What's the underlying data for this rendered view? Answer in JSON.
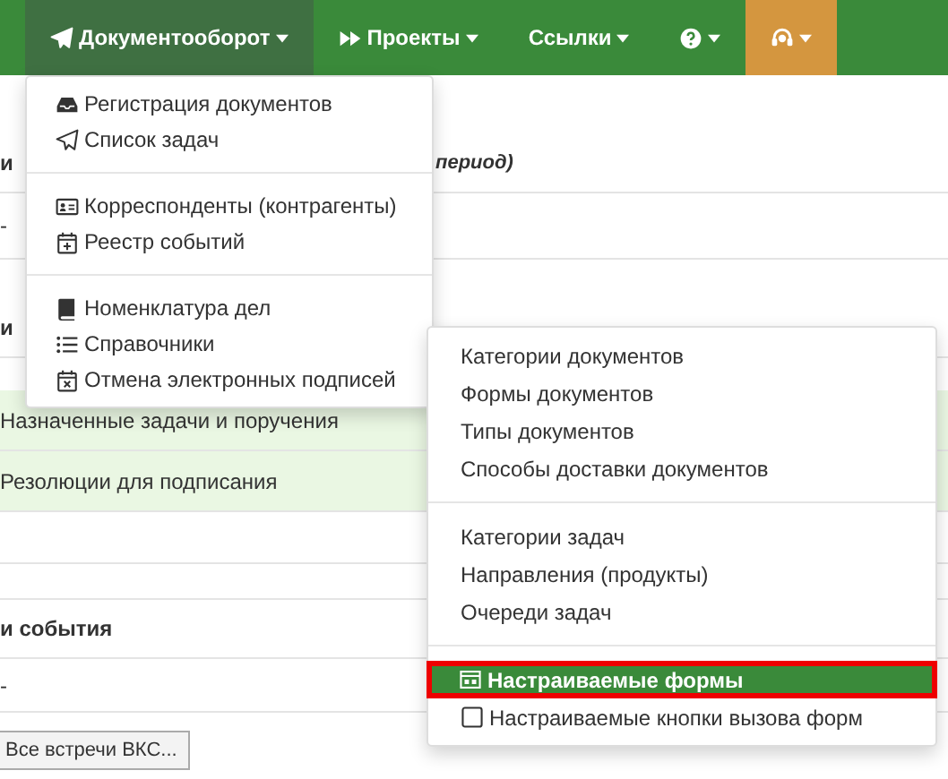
{
  "navbar": {
    "items": [
      {
        "label": "Документооборот",
        "kind": "plane",
        "selected": true,
        "accent": false
      },
      {
        "label": "Проекты",
        "kind": "forward",
        "selected": false,
        "accent": false
      },
      {
        "label": "Ссылки",
        "kind": "none",
        "selected": false,
        "accent": false
      },
      {
        "kind": "help",
        "selected": false,
        "accent": false
      },
      {
        "kind": "headset",
        "selected": false,
        "accent": true
      }
    ]
  },
  "page": {
    "rows": [
      {
        "kind": "header",
        "left": "и",
        "right": "период)"
      },
      {
        "kind": "plain",
        "left": "-"
      },
      {
        "kind": "header",
        "left": "и"
      },
      {
        "kind": "green",
        "left": "Назначенные задачи и поручения"
      },
      {
        "kind": "green",
        "left": "Резолюции для подписания"
      },
      {
        "kind": "plain"
      },
      {
        "kind": "header",
        "left": "и события"
      },
      {
        "kind": "plain",
        "left": "-"
      }
    ],
    "button": "Все встречи ВКС..."
  },
  "documents_menu": {
    "groups": [
      [
        {
          "label": "Регистрация документов",
          "kind": "inbox"
        },
        {
          "label": "Список задач",
          "kind": "plane"
        }
      ],
      [
        {
          "label": "Корреспонденты (контрагенты)",
          "kind": "card"
        },
        {
          "label": "Реестр событий",
          "kind": "calendar-plus"
        }
      ],
      [
        {
          "label": "Номенклатура дел",
          "kind": "book"
        },
        {
          "label": "Справочники",
          "kind": "list"
        },
        {
          "label": "Отмена электронных подписей",
          "kind": "calendar-x"
        }
      ]
    ]
  },
  "references_menu": {
    "groups": [
      [
        {
          "label": "Категории документов",
          "kind": "none",
          "selected": false
        },
        {
          "label": "Формы документов",
          "kind": "none",
          "selected": false
        },
        {
          "label": "Типы документов",
          "kind": "none",
          "selected": false
        },
        {
          "label": "Способы доставки документов",
          "kind": "none",
          "selected": false
        }
      ],
      [
        {
          "label": "Категории задач",
          "kind": "none",
          "selected": false
        },
        {
          "label": "Направления (продукты)",
          "kind": "none",
          "selected": false
        },
        {
          "label": "Очереди задач",
          "kind": "none",
          "selected": false
        }
      ],
      [
        {
          "label": "Настраиваемые формы",
          "kind": "window",
          "selected": true
        },
        {
          "label": "Настраиваемые кнопки вызова форм",
          "kind": "square",
          "selected": false
        }
      ]
    ]
  }
}
